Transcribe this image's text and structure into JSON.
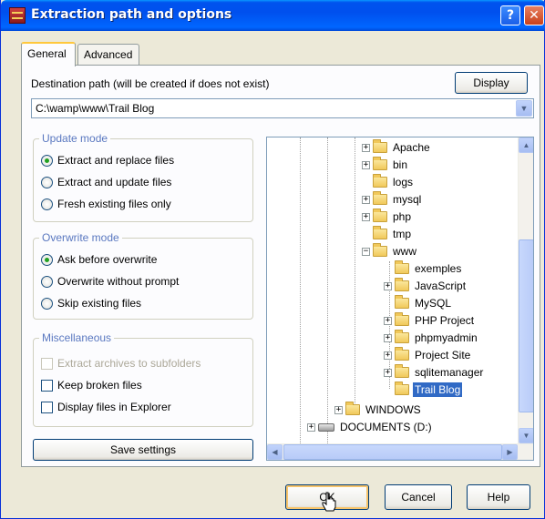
{
  "window": {
    "title": "Extraction path and options",
    "help_glyph": "?",
    "close_glyph": "✕"
  },
  "tabs": [
    {
      "label": "General",
      "active": true
    },
    {
      "label": "Advanced",
      "active": false
    }
  ],
  "destination": {
    "label": "Destination path (will be created if does not exist)",
    "value": "C:\\wamp\\www\\Trail Blog",
    "display_button": "Display"
  },
  "update_mode": {
    "title": "Update mode",
    "options": [
      {
        "label": "Extract and replace files",
        "selected": true
      },
      {
        "label": "Extract and update files",
        "selected": false
      },
      {
        "label": "Fresh existing files only",
        "selected": false
      }
    ]
  },
  "overwrite_mode": {
    "title": "Overwrite mode",
    "options": [
      {
        "label": "Ask before overwrite",
        "selected": true
      },
      {
        "label": "Overwrite without prompt",
        "selected": false
      },
      {
        "label": "Skip existing files",
        "selected": false
      }
    ]
  },
  "misc": {
    "title": "Miscellaneous",
    "options": [
      {
        "label": "Extract archives to subfolders",
        "checked": false,
        "disabled": true
      },
      {
        "label": "Keep broken files",
        "checked": false,
        "disabled": false
      },
      {
        "label": "Display files in Explorer",
        "checked": false,
        "disabled": false
      }
    ]
  },
  "save_settings": "Save settings",
  "tree": {
    "items": [
      {
        "label": "Apache",
        "expander": "+",
        "icon": "folder-icon"
      },
      {
        "label": "bin",
        "expander": "+",
        "icon": "folder-icon"
      },
      {
        "label": "logs",
        "expander": "",
        "icon": "folder-icon"
      },
      {
        "label": "mysql",
        "expander": "+",
        "icon": "folder-icon"
      },
      {
        "label": "php",
        "expander": "+",
        "icon": "folder-icon"
      },
      {
        "label": "tmp",
        "expander": "",
        "icon": "folder-icon"
      },
      {
        "label": "www",
        "expander": "−",
        "icon": "folder-open-icon"
      },
      {
        "label": "exemples",
        "expander": "",
        "icon": "folder-icon"
      },
      {
        "label": "JavaScript",
        "expander": "+",
        "icon": "folder-icon"
      },
      {
        "label": "MySQL",
        "expander": "",
        "icon": "folder-icon"
      },
      {
        "label": "PHP Project",
        "expander": "+",
        "icon": "folder-icon"
      },
      {
        "label": "phpmyadmin",
        "expander": "+",
        "icon": "folder-icon"
      },
      {
        "label": "Project Site",
        "expander": "+",
        "icon": "folder-icon"
      },
      {
        "label": "sqlitemanager",
        "expander": "+",
        "icon": "folder-icon"
      },
      {
        "label": "Trail Blog",
        "expander": "",
        "icon": "folder-icon",
        "selected": true
      },
      {
        "label": "WINDOWS",
        "expander": "+",
        "icon": "folder-icon"
      },
      {
        "label": "DOCUMENTS (D:)",
        "expander": "+",
        "icon": "drive-icon"
      }
    ]
  },
  "buttons": {
    "ok": "OK",
    "cancel": "Cancel",
    "help": "Help"
  }
}
